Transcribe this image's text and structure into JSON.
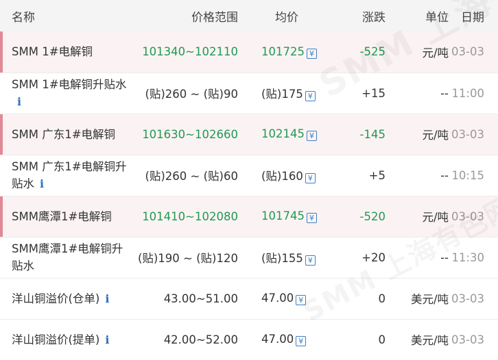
{
  "header": {
    "name": "名称",
    "range": "价格范围",
    "avg": "均价",
    "change": "涨跌",
    "unit": "单位",
    "date": "日期"
  },
  "watermark": "SMM 上海有色网",
  "icons": {
    "calendar": "calendar-icon",
    "info": "info-icon"
  },
  "colors": {
    "up_down_green": "#1f9a52",
    "row_accent": "#e08a95",
    "icon_blue": "#3a7fc4"
  },
  "rows": [
    {
      "name": "SMM 1#电解铜",
      "range": "101340~102110",
      "avg": "101725",
      "change": "-525",
      "unit": "元/吨",
      "date": "03-03"
    },
    {
      "name": "SMM 1#电解铜升贴水",
      "range": "(贴)260 ~ (贴)90",
      "avg": "(贴)175",
      "change": "+15",
      "unit": "--",
      "date": "11:00"
    },
    {
      "name": "SMM 广东1#电解铜",
      "range": "101630~102660",
      "avg": "102145",
      "change": "-145",
      "unit": "元/吨",
      "date": "03-03"
    },
    {
      "name": "SMM 广东1#电解铜升贴水",
      "range": "(贴)260 ~ (贴)60",
      "avg": "(贴)160",
      "change": "+5",
      "unit": "--",
      "date": "10:15"
    },
    {
      "name": "SMM鹰潭1#电解铜",
      "range": "101410~102080",
      "avg": "101745",
      "change": "-520",
      "unit": "元/吨",
      "date": "03-03"
    },
    {
      "name": "SMM鹰潭1#电解铜升贴水",
      "range": "(贴)190 ~ (贴)120",
      "avg": "(贴)155",
      "change": "+20",
      "unit": "--",
      "date": "11:30"
    },
    {
      "name": "洋山铜溢价(仓单)",
      "range": "43.00~51.00",
      "avg": "47.00",
      "change": "0",
      "unit": "美元/吨",
      "date": "03-03"
    },
    {
      "name": "洋山铜溢价(提单)",
      "range": "42.00~52.00",
      "avg": "47.00",
      "change": "0",
      "unit": "美元/吨",
      "date": "03-03"
    }
  ]
}
